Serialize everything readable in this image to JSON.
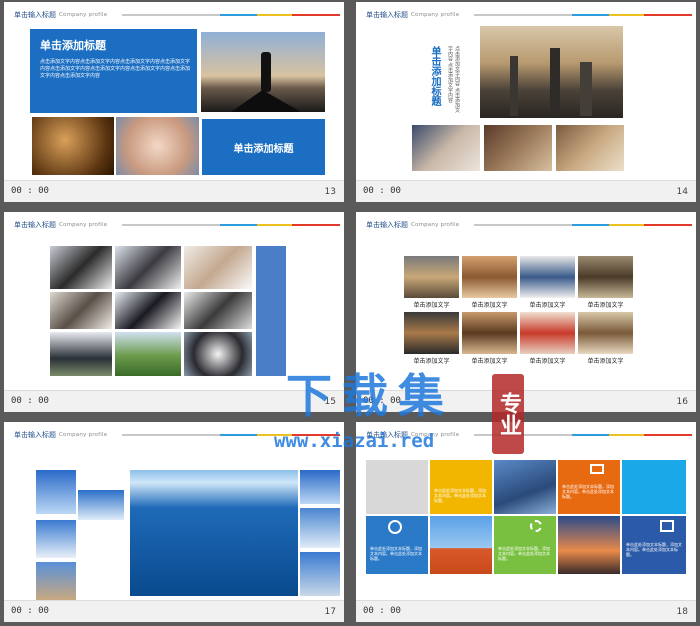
{
  "header": {
    "title": "单击输入标题",
    "subtitle": "Company  profile"
  },
  "time_label": "00 : 00",
  "slides": [
    {
      "number": "13",
      "heading": "单击添加标题",
      "heading2": "单击添加标题",
      "body": "点击添加文字内容点击添加文字内容点击添加文字内容点击添加文字内容点击添加文字内容点击添加文字内容点击添加文字内容点击添加文字内容点击添加文字内容"
    },
    {
      "number": "14",
      "vertical_title": "单击添加标题",
      "vertical_text": "点击添加文字内容 点击添加文字内容 点击添加文字内容"
    },
    {
      "number": "15"
    },
    {
      "number": "16",
      "captions": [
        "单击添加文字",
        "单击添加文字",
        "单击添加文字",
        "单击添加文字",
        "单击添加文字",
        "单击添加文字",
        "单击添加文字",
        "单击添加文字"
      ]
    },
    {
      "number": "17"
    },
    {
      "number": "18",
      "tile_text": "单击此处添加文本标题，添加文本内容。单击此处添加文本标题。"
    }
  ],
  "watermark": {
    "main": "下载集",
    "url": "www.xiazai.red",
    "seal": "专业"
  }
}
